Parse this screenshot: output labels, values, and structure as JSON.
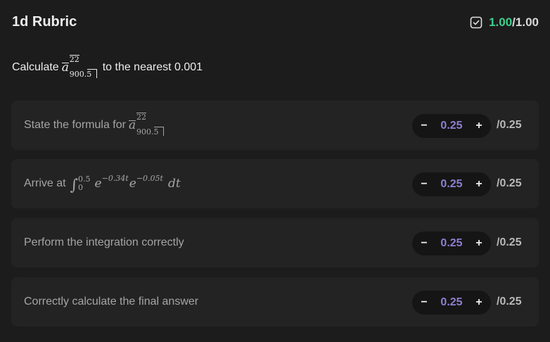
{
  "header": {
    "title": "1d Rubric",
    "score_got": "1.00",
    "score_sep": "/",
    "score_total": "1.00",
    "accent_color": "#3ecf8e"
  },
  "question": {
    "prefix": "Calculate",
    "symbol": "a",
    "sup": "22",
    "sub": "900.5",
    "suffix": "to the nearest 0.001"
  },
  "rubric": [
    {
      "label": "State the formula for",
      "symbol": "a",
      "sup": "22",
      "sub": "900.5",
      "value": "0.25",
      "max": "/0.25"
    },
    {
      "label": "Arrive at",
      "integral": {
        "upper": "0.5",
        "lower": "0",
        "e1": "e",
        "exp1": "−0.34t",
        "e2": "e",
        "exp2": "−0.05t",
        "dt": "dt"
      },
      "value": "0.25",
      "max": "/0.25"
    },
    {
      "label": "Perform the integration correctly",
      "value": "0.25",
      "max": "/0.25"
    },
    {
      "label": "Correctly calculate the final answer",
      "value": "0.25",
      "max": "/0.25"
    }
  ],
  "stepper": {
    "minus": "−",
    "plus": "+"
  },
  "icons": {
    "score": "check-square-icon"
  }
}
